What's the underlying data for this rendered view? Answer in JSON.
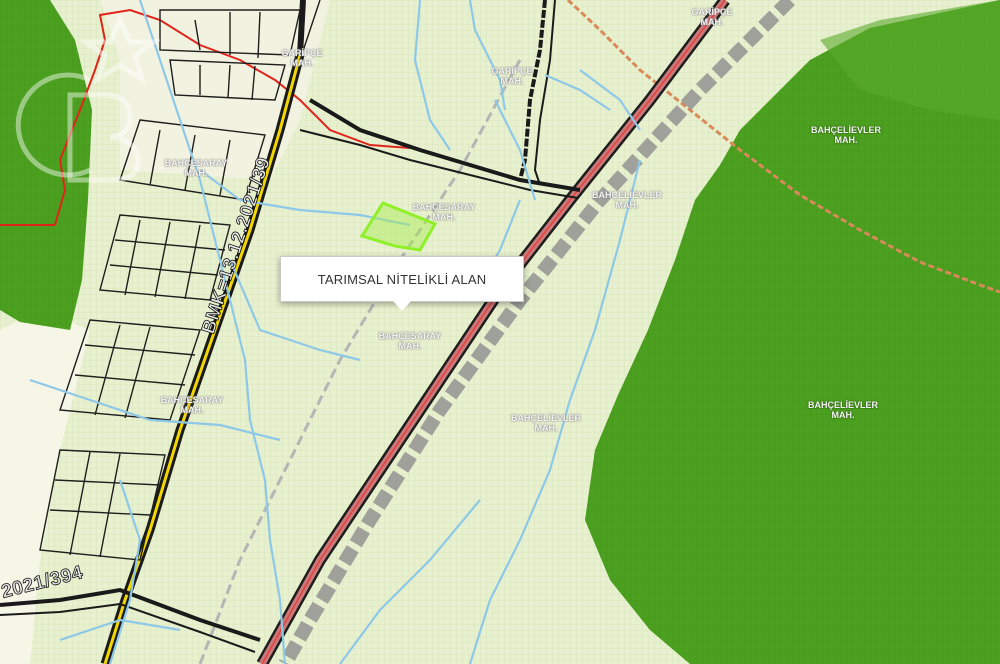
{
  "popup": {
    "text": "TARIMSAL NİTELİKLİ ALAN"
  },
  "plan_labels": {
    "diagonal": "BMK=13.12.2021/39",
    "bottom_left": "2021/394"
  },
  "neighborhoods": [
    {
      "id": "garipce-top",
      "text": "GARİPÇE\nMAH."
    },
    {
      "id": "garipce-mid",
      "text": "GARİPÇE\nMAH."
    },
    {
      "id": "garipce-left",
      "text": "GARİPÇE\nMAH."
    },
    {
      "id": "bahcesaray-1",
      "text": "BAHÇESARAY\nMAH."
    },
    {
      "id": "bahcesaray-2",
      "text": "BAHÇESARAY\nMAH."
    },
    {
      "id": "bahcesaray-3",
      "text": "BAHÇESARAY\nMAH."
    },
    {
      "id": "bahcesaray-4",
      "text": "BAHÇESARAY\nMAH."
    },
    {
      "id": "bahcelievler-1",
      "text": "BAHÇELİEVLER\nMAH."
    },
    {
      "id": "bahcelievler-2",
      "text": "BAHÇELİEVLER\nMAH."
    },
    {
      "id": "bahcelievler-3",
      "text": "BAHÇELİEVLER\nMAH."
    },
    {
      "id": "bahcelievler-4",
      "text": "BAHÇELİEVLER\nMAH."
    }
  ],
  "colors": {
    "agricultural": "#e8f1cf",
    "forest": "#4ca01f",
    "parcel_highlight": "#9ff040",
    "stream": "#8ec8e8",
    "boundary": "#e0241c",
    "railway": "#777777",
    "pipeline": "#d88a5a"
  }
}
